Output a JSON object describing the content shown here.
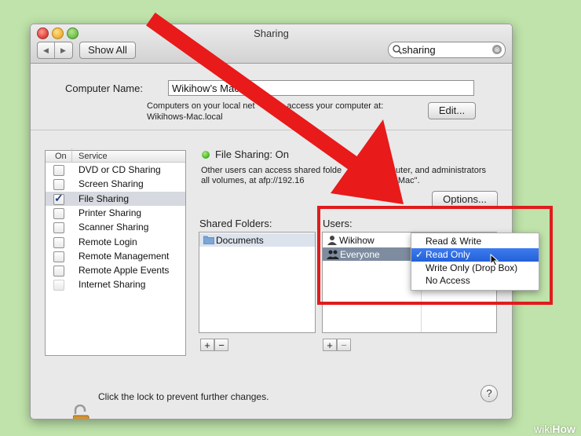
{
  "window": {
    "title": "Sharing",
    "nav": {
      "back": "◀",
      "forward": "▶"
    },
    "show_all": "Show All",
    "search": {
      "value": "sharing",
      "clear": "⊗"
    }
  },
  "computer": {
    "name_label": "Computer Name:",
    "name_value": "Wikihow’s Mac",
    "desc_line1": "Computers on your local net",
    "desc_line1_end": "can access your computer at:",
    "desc_line2": "Wikihows-Mac.local",
    "edit_button": "Edit..."
  },
  "services": {
    "col_on": "On",
    "col_service": "Service",
    "items": [
      {
        "label": "DVD or CD Sharing",
        "checked": false,
        "selected": false
      },
      {
        "label": "Screen Sharing",
        "checked": false,
        "selected": false
      },
      {
        "label": "File Sharing",
        "checked": true,
        "selected": true
      },
      {
        "label": "Printer Sharing",
        "checked": false,
        "selected": false
      },
      {
        "label": "Scanner Sharing",
        "checked": false,
        "selected": false
      },
      {
        "label": "Remote Login",
        "checked": false,
        "selected": false
      },
      {
        "label": "Remote Management",
        "checked": false,
        "selected": false
      },
      {
        "label": "Remote Apple Events",
        "checked": false,
        "selected": false
      },
      {
        "label": "Internet Sharing",
        "checked": false,
        "selected": false
      }
    ]
  },
  "file_sharing": {
    "status": "File Sharing: On",
    "desc_line1_a": "Other users can access shared folde",
    "desc_line1_b": "computer, and administrators",
    "desc_line2_a": "all volumes, at afp://192.16",
    "desc_line2_b": "ikihow’s Mac\".",
    "options_button": "Options..."
  },
  "shared_folders": {
    "label": "Shared Folders:",
    "items": [
      "Documents"
    ],
    "add": "+",
    "remove": "−"
  },
  "users": {
    "label": "Users:",
    "items": [
      "Wikihow",
      "Everyone"
    ],
    "add": "+",
    "remove": "−"
  },
  "permission_menu": {
    "items": [
      "Read & Write",
      "Read Only",
      "Write Only (Drop Box)",
      "No Access"
    ],
    "selected": "Read Only",
    "check": "✓"
  },
  "footer": {
    "lock_text": "Click the lock to prevent further changes.",
    "help": "?"
  },
  "watermark": {
    "prefix": "wiki",
    "brand": "How"
  },
  "colors": {
    "annotation_red": "#e01c1c",
    "highlight": "#2461d8",
    "status_green": "#3fae20"
  }
}
